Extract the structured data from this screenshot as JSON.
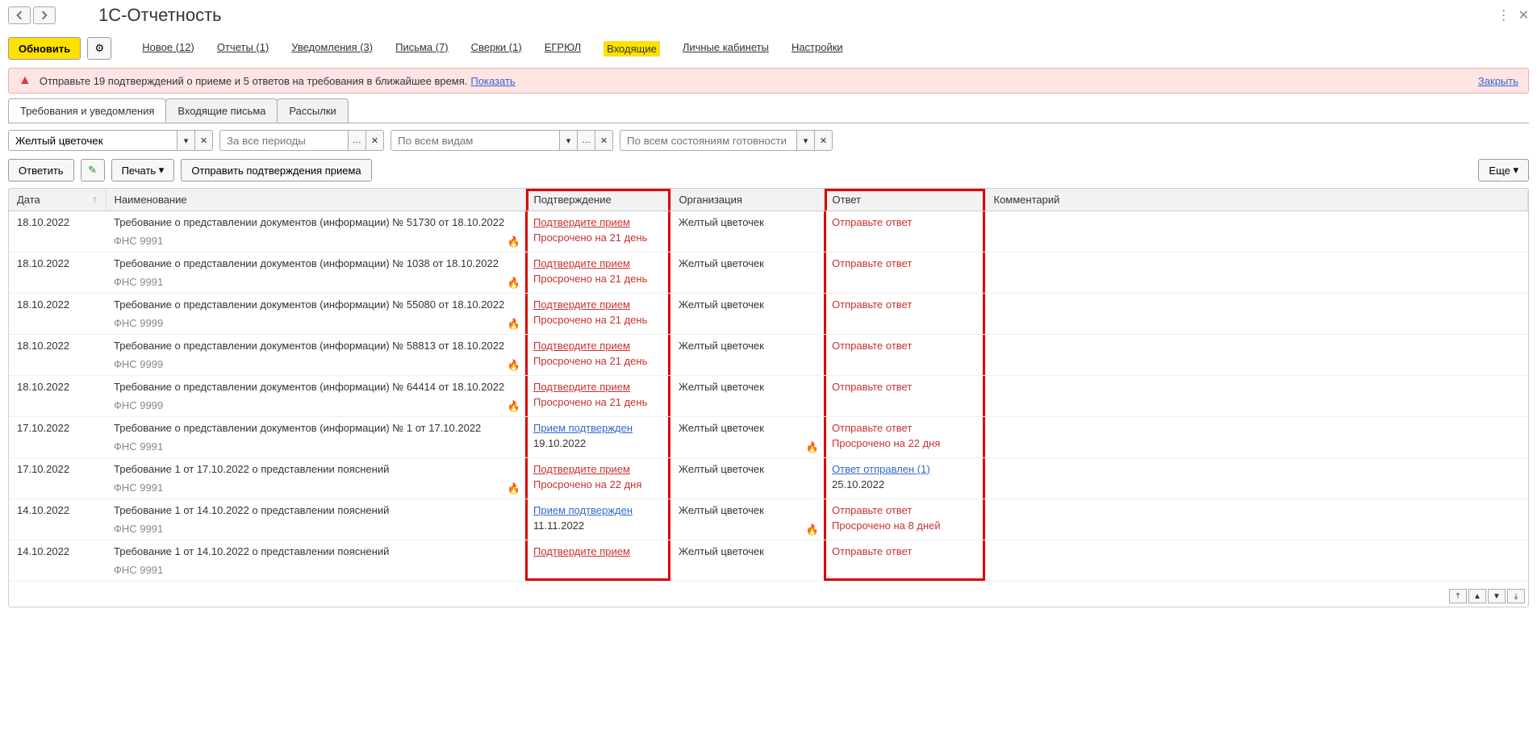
{
  "title": "1С-Отчетность",
  "toolbar": {
    "update": "Обновить",
    "links": [
      "Новое (12)",
      "Отчеты (1)",
      "Уведомления (3)",
      "Письма (7)",
      "Сверки (1)",
      "ЕГРЮЛ",
      "Входящие",
      "Личные кабинеты",
      "Настройки"
    ]
  },
  "alert": {
    "text": "Отправьте 19 подтверждений о приеме и 5 ответов на требования в ближайшее время.",
    "show": "Показать",
    "close": "Закрыть"
  },
  "tabs": [
    "Требования и уведомления",
    "Входящие письма",
    "Рассылки"
  ],
  "filters": {
    "org": "Желтый цветочек",
    "period_ph": "За все периоды",
    "kind_ph": "По всем видам",
    "status_ph": "По всем состояниям готовности"
  },
  "actions": {
    "reply": "Ответить",
    "print": "Печать",
    "send_confirm": "Отправить подтверждения приема",
    "more": "Еще"
  },
  "columns": {
    "date": "Дата",
    "name": "Наименование",
    "confirm": "Подтверждение",
    "org": "Организация",
    "answer": "Ответ",
    "comment": "Комментарий"
  },
  "rows": [
    {
      "date": "18.10.2022",
      "name": "Требование о представлении документов (информации) № 51730 от 18.10.2022",
      "sub": "ФНС 9991",
      "confirm": "Подтвердите прием",
      "confirm_sub": "Просрочено на 21 день",
      "confirm_link": true,
      "fire_conf": true,
      "org": "Желтый цветочек",
      "answer": "Отправьте ответ",
      "answer_red": true
    },
    {
      "date": "18.10.2022",
      "name": "Требование о представлении документов (информации) № 1038 от 18.10.2022",
      "sub": "ФНС 9991",
      "confirm": "Подтвердите прием",
      "confirm_sub": "Просрочено на 21 день",
      "confirm_link": true,
      "fire_conf": true,
      "org": "Желтый цветочек",
      "answer": "Отправьте ответ",
      "answer_red": true
    },
    {
      "date": "18.10.2022",
      "name": "Требование о представлении документов (информации) № 55080 от 18.10.2022",
      "sub": "ФНС 9999",
      "confirm": "Подтвердите прием",
      "confirm_sub": "Просрочено на 21 день",
      "confirm_link": true,
      "fire_conf": true,
      "org": "Желтый цветочек",
      "answer": "Отправьте ответ",
      "answer_red": true
    },
    {
      "date": "18.10.2022",
      "name": "Требование о представлении документов (информации) № 58813 от 18.10.2022",
      "sub": "ФНС 9999",
      "confirm": "Подтвердите прием",
      "confirm_sub": "Просрочено на 21 день",
      "confirm_link": true,
      "fire_conf": true,
      "org": "Желтый цветочек",
      "answer": "Отправьте ответ",
      "answer_red": true
    },
    {
      "date": "18.10.2022",
      "name": "Требование о представлении документов (информации) № 64414 от 18.10.2022",
      "sub": "ФНС 9999",
      "confirm": "Подтвердите прием",
      "confirm_sub": "Просрочено на 21 день",
      "confirm_link": true,
      "fire_conf": true,
      "org": "Желтый цветочек",
      "answer": "Отправьте ответ",
      "answer_red": true
    },
    {
      "date": "17.10.2022",
      "name": "Требование о представлении документов (информации) № 1 от 17.10.2022",
      "sub": "ФНС 9991",
      "confirm": "Прием подтвержден",
      "confirm_sub": "19.10.2022",
      "confirm_link": false,
      "confirm_blue": true,
      "fire_ans": true,
      "org": "Желтый цветочек",
      "answer": "Отправьте ответ",
      "answer_sub": "Просрочено на 22 дня",
      "answer_red": true
    },
    {
      "date": "17.10.2022",
      "name": "Требование 1 от 17.10.2022 о представлении пояснений",
      "sub": "ФНС 9991",
      "confirm": "Подтвердите прием",
      "confirm_sub": "Просрочено на 22 дня",
      "confirm_link": true,
      "fire_conf": true,
      "org": "Желтый цветочек",
      "answer": "Ответ отправлен (1)",
      "answer_sub": "25.10.2022",
      "answer_blue": true
    },
    {
      "date": "14.10.2022",
      "name": "Требование 1 от 14.10.2022 о представлении пояснений",
      "sub": "ФНС 9991",
      "confirm": "Прием подтвержден",
      "confirm_sub": "11.11.2022",
      "confirm_link": false,
      "confirm_blue": true,
      "fire_ans": true,
      "org": "Желтый цветочек",
      "answer": "Отправьте ответ",
      "answer_sub": "Просрочено на 8 дней",
      "answer_red": true
    },
    {
      "date": "14.10.2022",
      "name": "Требование 1 от 14.10.2022 о представлении пояснений",
      "sub": "ФНС 9991",
      "confirm": "Подтвердите прием",
      "confirm_sub": "",
      "confirm_link": true,
      "org": "Желтый цветочек",
      "answer": "Отправьте ответ",
      "answer_red": true
    }
  ]
}
